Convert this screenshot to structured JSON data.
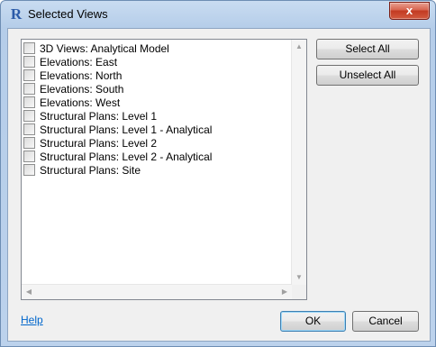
{
  "window": {
    "title": "Selected Views",
    "icon": "revit-r-icon",
    "icon_letter": "R",
    "close_label": "x"
  },
  "views_list": {
    "items": [
      {
        "label": "3D Views: Analytical Model",
        "checked": false
      },
      {
        "label": "Elevations: East",
        "checked": false
      },
      {
        "label": "Elevations: North",
        "checked": false
      },
      {
        "label": "Elevations: South",
        "checked": false
      },
      {
        "label": "Elevations: West",
        "checked": false
      },
      {
        "label": "Structural Plans: Level 1",
        "checked": false
      },
      {
        "label": "Structural Plans: Level 1 - Analytical",
        "checked": false
      },
      {
        "label": "Structural Plans: Level 2",
        "checked": false
      },
      {
        "label": "Structural Plans: Level 2 - Analytical",
        "checked": false
      },
      {
        "label": "Structural Plans: Site",
        "checked": false
      }
    ]
  },
  "buttons": {
    "select_all": "Select All",
    "unselect_all": "Unselect All",
    "ok": "OK",
    "cancel": "Cancel"
  },
  "footer": {
    "help_label": "Help"
  },
  "colors": {
    "link": "#0066cc",
    "close_button": "#c23a22",
    "title_bar": "#b5cde9"
  }
}
